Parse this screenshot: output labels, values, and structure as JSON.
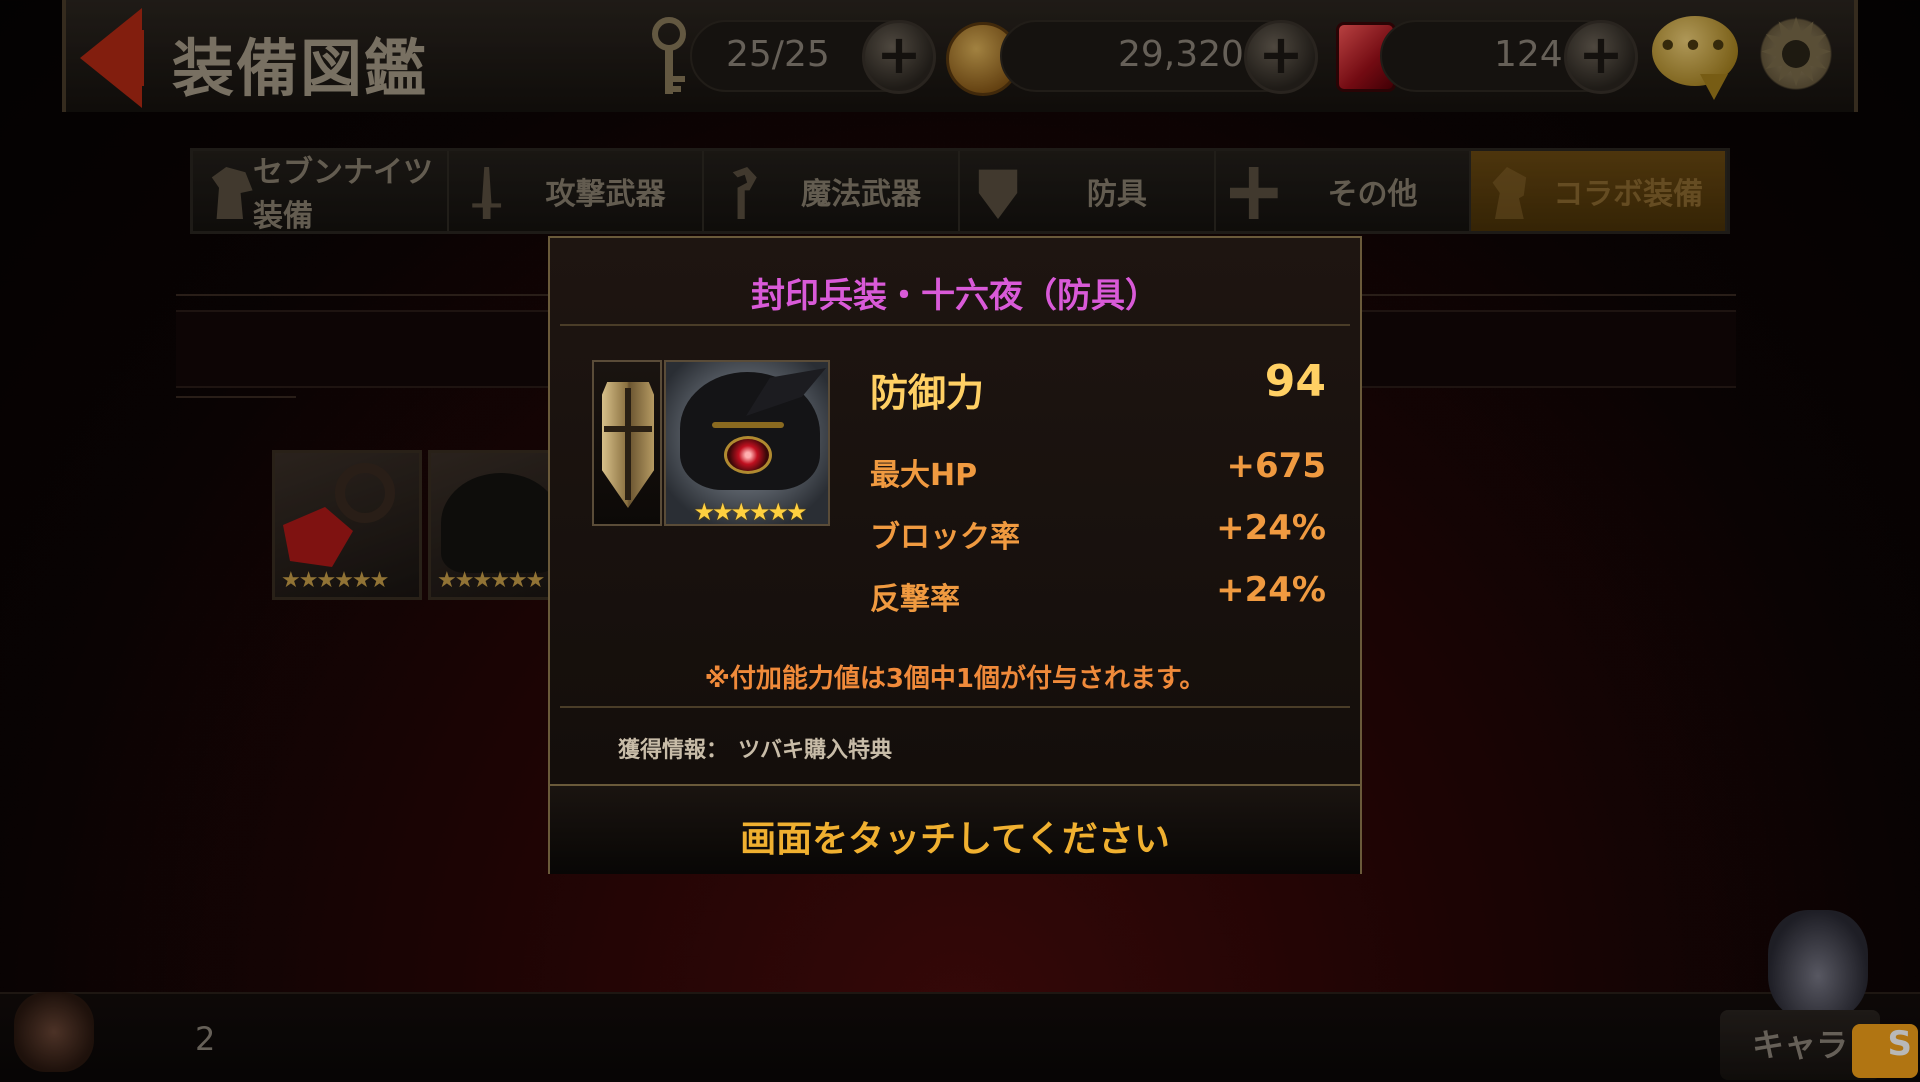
{
  "header": {
    "title": "装備図鑑",
    "stamina": "25/25",
    "gold": "29,320",
    "gems": "124"
  },
  "tabs": [
    {
      "label": "セブンナイツ装備",
      "icon": "horse-icon"
    },
    {
      "label": "攻撃武器",
      "icon": "sword-icon"
    },
    {
      "label": "魔法武器",
      "icon": "staff-icon"
    },
    {
      "label": "防具",
      "icon": "shield-icon"
    },
    {
      "label": "その他",
      "icon": "dpad-icon"
    },
    {
      "label": "コラボ装備",
      "icon": "knight-chess-icon",
      "active": true
    }
  ],
  "background_list": {
    "items": [
      {
        "stars": "★★★★★★"
      },
      {
        "stars": "★★★★★★"
      }
    ],
    "page_count": "2",
    "bottom_button": "キャラ"
  },
  "modal": {
    "title": "封印兵装・十六夜（防具）",
    "item_stars": "★★★★★★",
    "main_stat": {
      "label": "防御力",
      "value": "94"
    },
    "stats": [
      {
        "label": "最大HP",
        "value": "+675"
      },
      {
        "label": "ブロック率",
        "value": "+24%"
      },
      {
        "label": "反撃率",
        "value": "+24%"
      }
    ],
    "note": "※付加能力値は3個中1個が付与されます。",
    "acquisition_label": "獲得情報：",
    "acquisition_value": "ツバキ購入特典",
    "touch_prompt": "画面をタッチしてください"
  },
  "colors": {
    "title_purple": "#d95ad8",
    "stat_gold": "#ffd064",
    "stat_orange": "#f09a40",
    "prompt_gold": "#f0b030",
    "active_tab": "#6b4a12"
  }
}
